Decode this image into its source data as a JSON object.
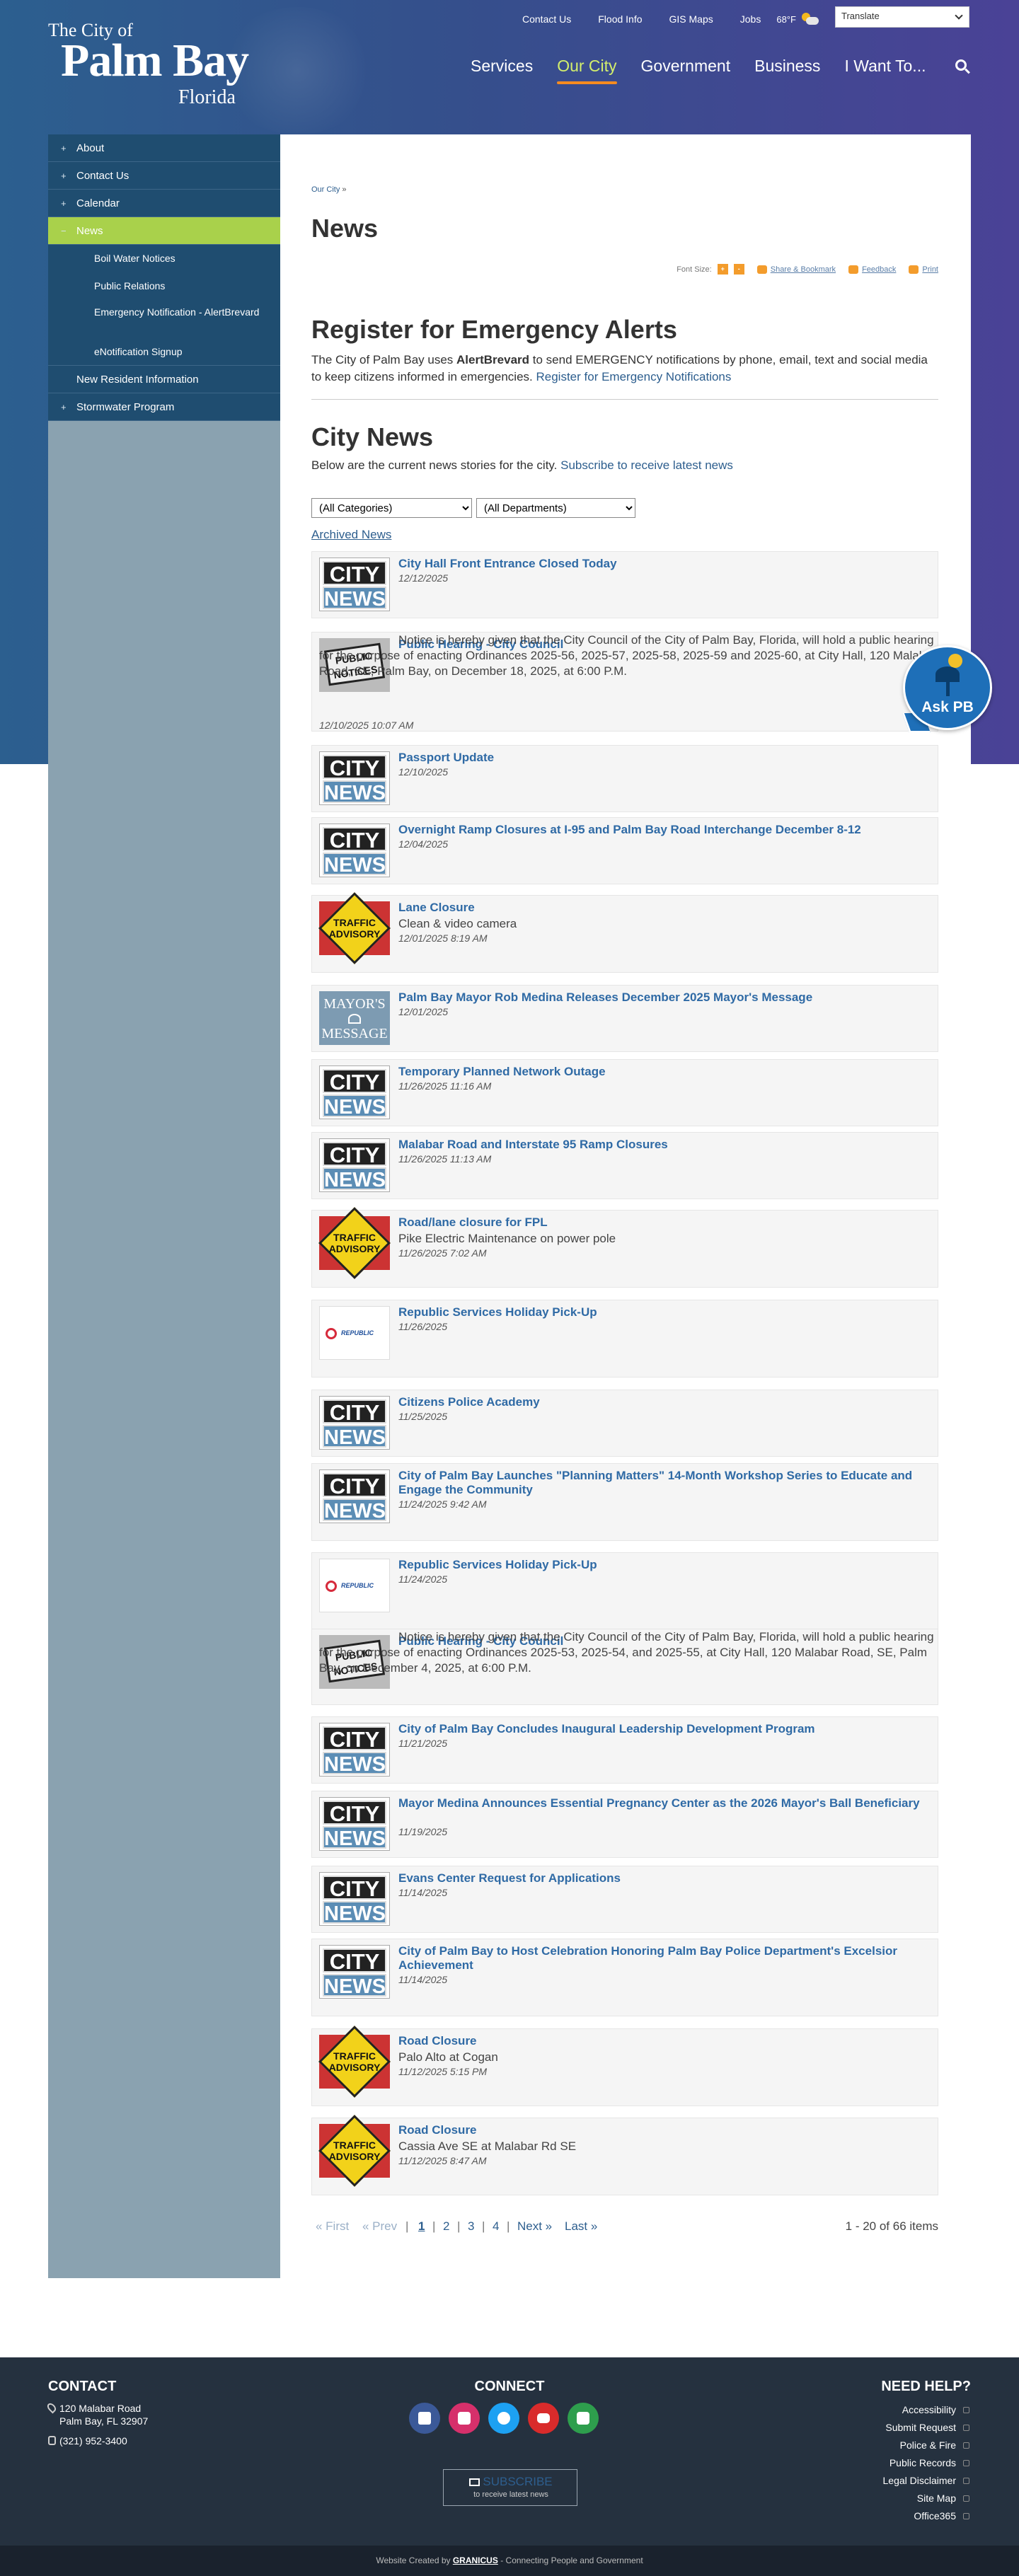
{
  "header": {
    "logo": {
      "line1": "The City of",
      "line2": "Palm Bay",
      "line3": "Florida"
    },
    "utility": [
      "Contact Us",
      "Flood Info",
      "GIS Maps",
      "Jobs"
    ],
    "weather": "68°F",
    "translate": "Translate",
    "nav": [
      "Services",
      "Our City",
      "Government",
      "Business",
      "I Want To..."
    ]
  },
  "sidebar": {
    "items": [
      {
        "mark": "+",
        "label": "About"
      },
      {
        "mark": "+",
        "label": "Contact Us"
      },
      {
        "mark": "+",
        "label": "Calendar"
      },
      {
        "mark": "−",
        "label": "News"
      },
      {
        "label": "Boil Water Notices"
      },
      {
        "label": "Public Relations"
      },
      {
        "label": "Emergency Notification - AlertBrevard"
      },
      {
        "label": "eNotification Signup"
      },
      {
        "label": "New Resident Information"
      },
      {
        "mark": "+",
        "label": "Stormwater Program"
      }
    ]
  },
  "breadcrumb": {
    "link": "Our City",
    "sep": "»"
  },
  "page_title": "News",
  "tools": {
    "font_size": "Font Size:",
    "plus": "+",
    "minus": "-",
    "share": "Share & Bookmark",
    "feedback": "Feedback",
    "print": "Print"
  },
  "alerts": {
    "title": "Register for Emergency Alerts",
    "text_a": "The City of Palm Bay uses ",
    "text_b": "AlertBrevard",
    "text_c": " to send EMERGENCY notifications by phone, email, text and social media to keep citizens informed in emergencies. ",
    "link": "Register for Emergency Notifications"
  },
  "city_news": {
    "title": "City News",
    "intro": "Below are the current news stories for the city. ",
    "subscribe_link": "Subscribe to receive latest news",
    "category": "(All Categories)",
    "department": "(All Departments)",
    "archived": "Archived News"
  },
  "news": [
    {
      "thumb": "city",
      "title": "City Hall Front Entrance Closed Today",
      "date": "12/12/2025"
    },
    {
      "thumb": "public",
      "title": "Public Hearing - City Council",
      "sub": "Notice is hereby given that the City Council of the City of Palm Bay, Florida, will hold a public hearing for the purpose of enacting Ordinances 2025-56, 2025-57, 2025-58, 2025-59 and 2025-60, at City Hall, 120 Malabar Road, SE, Palm Bay, on December 18, 2025, at 6:00 P.M.",
      "date": "12/10/2025 10:07 AM"
    },
    {
      "thumb": "city",
      "title": "Passport Update",
      "date": "12/10/2025"
    },
    {
      "thumb": "city",
      "title": "Overnight Ramp Closures at I-95 and Palm Bay Road Interchange December 8-12",
      "date": "12/04/2025"
    },
    {
      "thumb": "traffic",
      "title": "Lane Closure",
      "sub": "Clean & video camera",
      "date": "12/01/2025 8:19 AM"
    },
    {
      "thumb": "mayor",
      "title": "Palm Bay Mayor Rob Medina Releases December 2025 Mayor's Message",
      "date": "12/01/2025"
    },
    {
      "thumb": "city",
      "title": "Temporary Planned Network Outage",
      "date": "11/26/2025 11:16 AM"
    },
    {
      "thumb": "city",
      "title": "Malabar Road and Interstate 95 Ramp Closures",
      "date": "11/26/2025 11:13 AM"
    },
    {
      "thumb": "traffic",
      "title": "Road/lane closure for FPL",
      "sub": "Pike Electric Maintenance on power pole",
      "date": "11/26/2025 7:02 AM"
    },
    {
      "thumb": "republic",
      "title": "Republic Services Holiday Pick-Up",
      "date": "11/26/2025"
    },
    {
      "thumb": "city",
      "title": "Citizens Police Academy",
      "date": "11/25/2025"
    },
    {
      "thumb": "city",
      "title": "City of Palm Bay Launches \"Planning Matters\" 14-Month Workshop Series to Educate and Engage the Community",
      "date": "11/24/2025 9:42 AM"
    },
    {
      "thumb": "republic",
      "title": "Republic Services Holiday Pick-Up",
      "date": "11/24/2025"
    },
    {
      "thumb": "public",
      "title": "Public Hearing - City Council",
      "sub": "Notice is hereby given that the City Council of the City of Palm Bay, Florida, will hold a public hearing for the purpose of enacting Ordinances 2025-53, 2025-54, and 2025-55, at City Hall, 120 Malabar Road, SE, Palm Bay, on December 4, 2025, at 6:00 P.M.",
      "date": "11/21/2025 3:31 PM"
    },
    {
      "thumb": "city",
      "title": "City of Palm Bay Concludes Inaugural Leadership Development Program",
      "date": "11/21/2025"
    },
    {
      "thumb": "city",
      "title": "Mayor Medina Announces Essential Pregnancy Center as the 2026 Mayor's Ball Beneficiary",
      "date": "11/19/2025"
    },
    {
      "thumb": "city",
      "title": "Evans Center Request for Applications",
      "date": "11/14/2025"
    },
    {
      "thumb": "city",
      "title": "City of Palm Bay to Host Celebration Honoring Palm Bay Police Department's Excelsior Achievement",
      "date": "11/14/2025"
    },
    {
      "thumb": "traffic",
      "title": "Road Closure",
      "sub": "Palo Alto at Cogan",
      "date": "11/12/2025 5:15 PM"
    },
    {
      "thumb": "traffic",
      "title": "Road Closure",
      "sub": "Cassia Ave SE at Malabar Rd SE",
      "date": "11/12/2025 8:47 AM"
    }
  ],
  "thumb_text": {
    "city1": "CITY",
    "city2": "NEWS",
    "public1": "PUBLIC",
    "public2": "NOTICES",
    "traffic1": "TRAFFIC",
    "traffic2": "ADVISORY",
    "mayor1": "MAYOR'S",
    "mayor2": "MESSAGE",
    "republic": "REPUBLIC"
  },
  "pager": {
    "first": "« First",
    "prev": "« Prev",
    "pages": [
      "1",
      "2",
      "3",
      "4"
    ],
    "next": "Next »",
    "last": "Last »",
    "count": "1 - 20 of 66 items"
  },
  "ask": "Ask PB",
  "footer": {
    "contact_title": "CONTACT",
    "addr1": "120 Malabar Road",
    "addr2": "Palm Bay, FL 32907",
    "phone": "(321) 952-3400",
    "connect_title": "CONNECT",
    "subscribe": "SUBSCRIBE",
    "subscribe_sub": "to receive latest news",
    "help_title": "NEED HELP?",
    "links": [
      "Accessibility",
      "Submit Request",
      "Police & Fire",
      "Public Records",
      "Legal Disclaimer",
      "Site Map",
      "Office365"
    ],
    "credit_a": "Website Created by ",
    "credit_b": "GRANICUS",
    "credit_c": " - Connecting People and Government"
  },
  "colors": {
    "accent": "#a9d14b",
    "nav_active": "#d3ef6c",
    "underline": "#f68b1f",
    "link": "#2f6aa5",
    "sidenav": "#1f4d70"
  }
}
